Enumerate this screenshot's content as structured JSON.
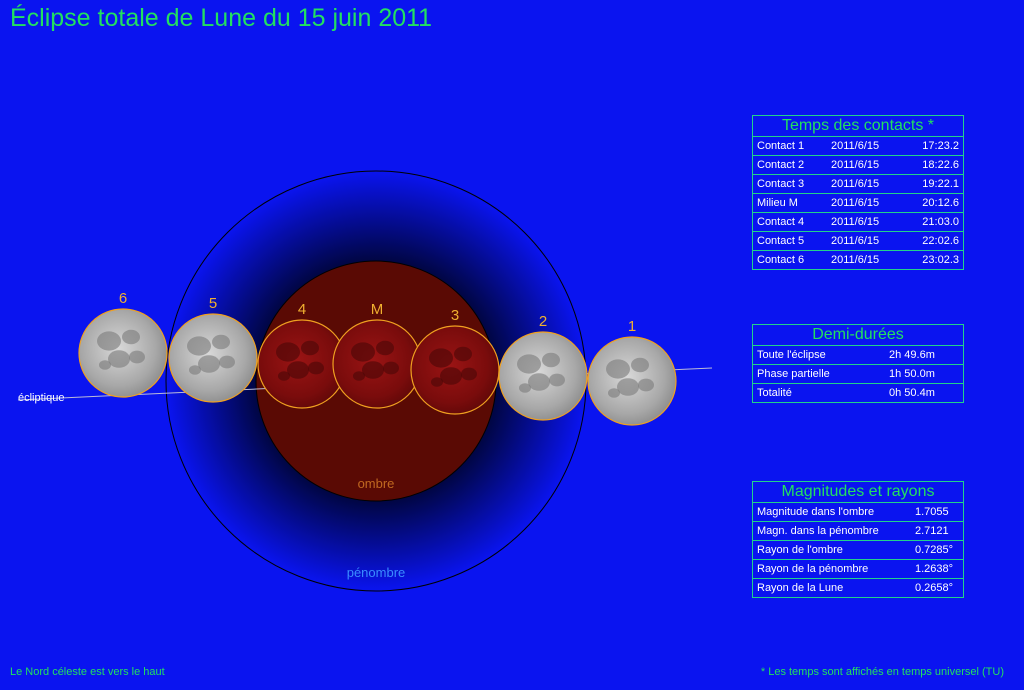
{
  "title": "Éclipse totale de Lune du 15 juin 2011",
  "diagram": {
    "ecliptic_label": "écliptique",
    "umbra_label": "ombre",
    "penumbra_label": "pénombre",
    "moons": [
      {
        "label": "6",
        "phase": "full"
      },
      {
        "label": "5",
        "phase": "full"
      },
      {
        "label": "4",
        "phase": "eclipsed"
      },
      {
        "label": "M",
        "phase": "eclipsed"
      },
      {
        "label": "3",
        "phase": "eclipsed"
      },
      {
        "label": "2",
        "phase": "full"
      },
      {
        "label": "1",
        "phase": "full"
      }
    ],
    "colors": {
      "background": "#0a14f0",
      "umbra": "#5a0a04",
      "moon_outline": "#f0a020",
      "label": "#f0b030",
      "text_green": "#22e060"
    }
  },
  "contacts": {
    "title": "Temps des contacts *",
    "rows": [
      {
        "name": "Contact 1",
        "date": "2011/6/15",
        "time": "17:23.2"
      },
      {
        "name": "Contact 2",
        "date": "2011/6/15",
        "time": "18:22.6"
      },
      {
        "name": "Contact 3",
        "date": "2011/6/15",
        "time": "19:22.1"
      },
      {
        "name": "Milieu M",
        "date": "2011/6/15",
        "time": "20:12.6"
      },
      {
        "name": "Contact 4",
        "date": "2011/6/15",
        "time": "21:03.0"
      },
      {
        "name": "Contact 5",
        "date": "2011/6/15",
        "time": "22:02.6"
      },
      {
        "name": "Contact 6",
        "date": "2011/6/15",
        "time": "23:02.3"
      }
    ]
  },
  "durations": {
    "title": "Demi-durées",
    "rows": [
      {
        "name": "Toute l'éclipse",
        "value": "2h 49.6m"
      },
      {
        "name": "Phase partielle",
        "value": "1h 50.0m"
      },
      {
        "name": "Totalité",
        "value": "0h 50.4m"
      }
    ]
  },
  "magnitudes": {
    "title": "Magnitudes et rayons",
    "rows": [
      {
        "name": "Magnitude dans l'ombre",
        "value": "1.7055"
      },
      {
        "name": "Magn. dans la pénombre",
        "value": "2.7121"
      },
      {
        "name": "Rayon de l'ombre",
        "value": "0.7285°"
      },
      {
        "name": "Rayon de la pénombre",
        "value": "1.2638°"
      },
      {
        "name": "Rayon de la Lune",
        "value": "0.2658°"
      }
    ]
  },
  "footer": {
    "left": "Le Nord céleste est vers le haut",
    "right": "* Les temps sont affichés en temps universel (TU)"
  }
}
